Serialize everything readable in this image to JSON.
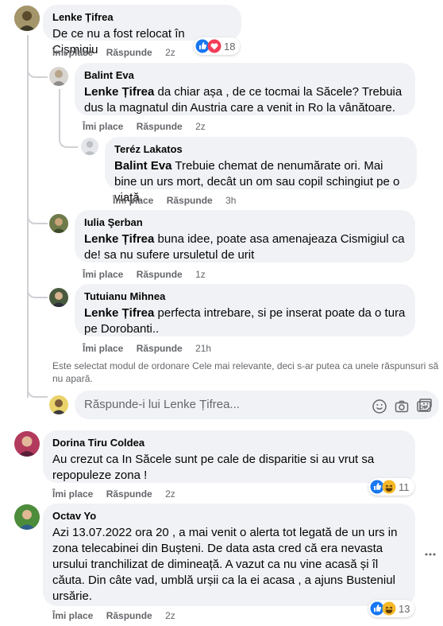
{
  "actions": {
    "like": "Îmi place",
    "reply": "Răspunde"
  },
  "colors": {
    "like_blue": "#1877f2",
    "love_red": "#f33e58",
    "haha_yellow": "#f7b928",
    "thread_line": "#ced0d4",
    "bubble_bg": "#f0f2f5"
  },
  "comments": [
    {
      "author": "Lenke Țifrea",
      "text": "De ce nu a fost relocat în Cișmigiu",
      "time": "2z",
      "reactions": {
        "icons": [
          "like-icon",
          "love-icon"
        ],
        "count": "18"
      }
    },
    {
      "author": "Balint Eva",
      "mention": "Lenke Țifrea",
      "text": " da chiar așa , de ce tocmai la Săcele? Trebuia dus la magnatul din Austria care a venit in Ro la vânătoare.",
      "time": "2z"
    },
    {
      "author": "Teréz Lakatos",
      "mention": "Balint Eva",
      "text": " Trebuie chemat de nenumărate ori. Mai bine un urs mort, decât un om sau copil schingiut pe o viață.",
      "time": "3h"
    },
    {
      "author": "Iulia Şerban",
      "mention": "Lenke Țifrea",
      "text": " buna idee, poate asa amenajeaza Cismigiul ca de! sa nu sufere ursuletul de urit",
      "time": "1z"
    },
    {
      "author": "Tutuianu Mihnea",
      "mention": "Lenke Țifrea",
      "text": " perfecta intrebare, si pe inserat poate da o tura pe Dorobanti..",
      "time": "21h"
    },
    {
      "author": "Dorina Tiru Coldea",
      "text": "Au crezut ca In Săcele sunt pe cale de disparitie si au vrut sa repopuleze zona !",
      "time": "2z",
      "reactions": {
        "icons": [
          "like-icon",
          "haha-icon"
        ],
        "count": "11"
      }
    },
    {
      "author": "Octav Yo",
      "text": "Azi 13.07.2022 ora 20 , a mai venit o alerta tot legată de un urs in zona telecabinei din Bușteni. De data asta cred că era nevasta ursului tranchilizat de dimineață. A vazut ca nu vine acasă și îl căuta. Din câte vad, umblă urșii ca la ei acasa , a ajuns Busteniul ursărie.",
      "time": "2z",
      "reactions": {
        "icons": [
          "like-icon",
          "haha-icon"
        ],
        "count": "13"
      }
    }
  ],
  "sort_notice": "Este selectat modul de ordonare Cele mai relevante, deci s-ar putea ca unele răspunsuri să nu apară.",
  "reply_input": {
    "placeholder": "Răspunde-i lui Lenke Țifrea...",
    "icons": [
      "emoji-icon",
      "camera-icon",
      "gif-icon",
      "sticker-icon"
    ]
  },
  "more_menu_icon": "more-options-icon"
}
